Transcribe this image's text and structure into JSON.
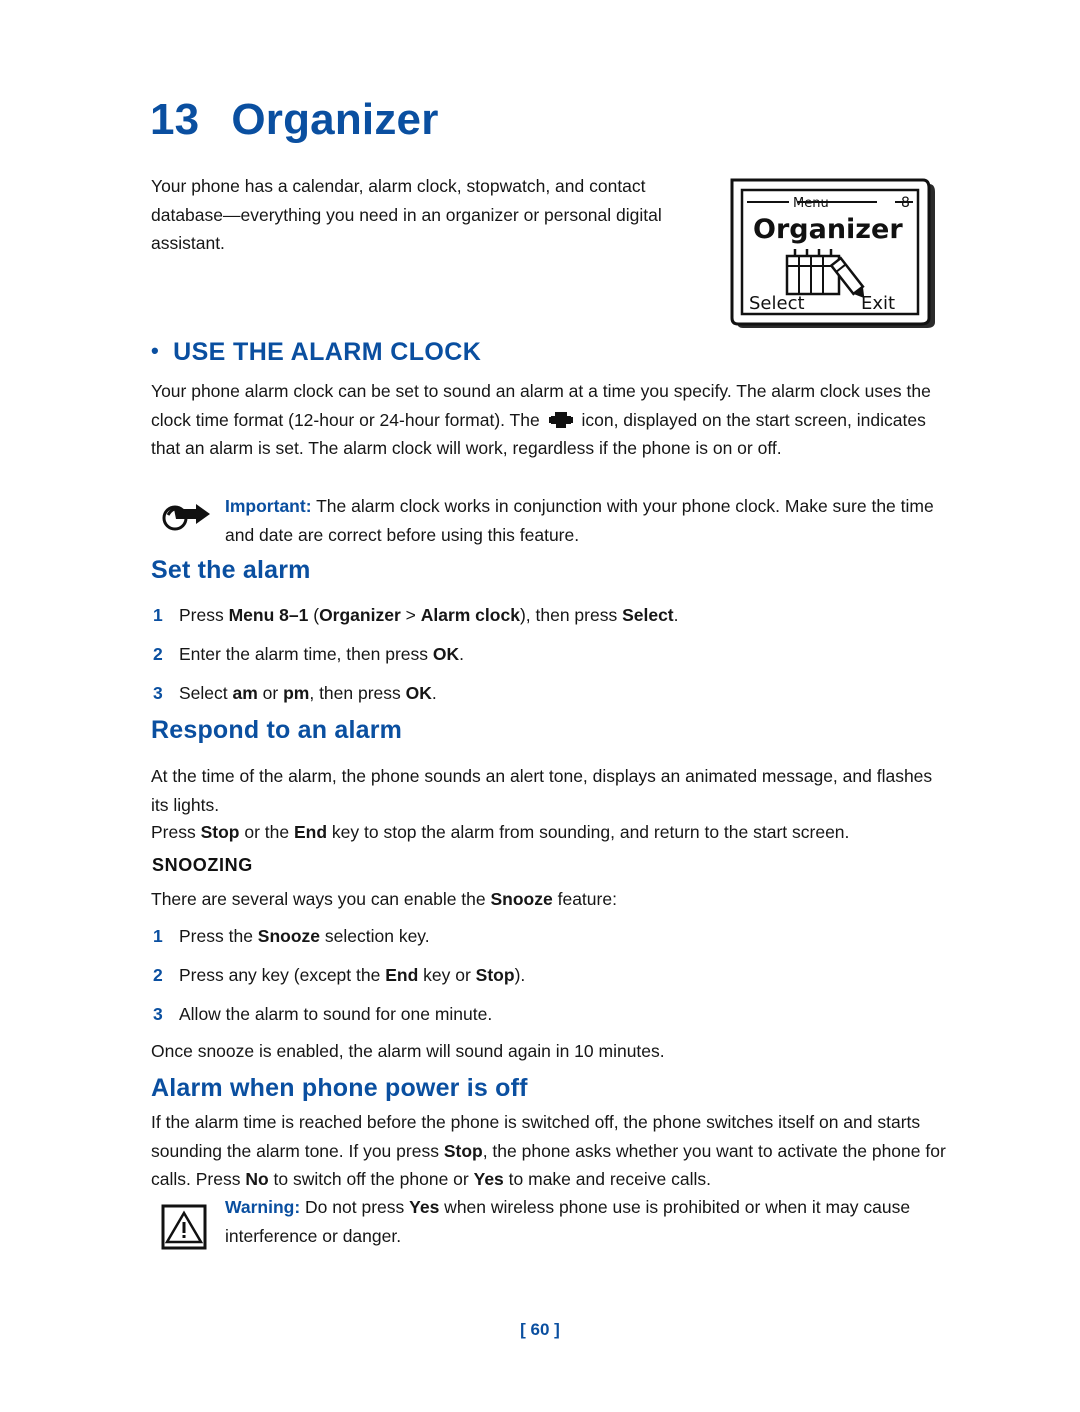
{
  "chapter": {
    "number": "13",
    "title": "Organizer"
  },
  "intro": "Your phone has a calendar, alarm clock, stopwatch, and contact database—everything you need in an organizer or personal digital assistant.",
  "illustration": {
    "name": "organizer-menu-screen",
    "top_left_label": "Menu",
    "top_right_label": "8",
    "title": "Organizer",
    "left_softkey": "Select",
    "right_softkey": "Exit"
  },
  "sections": {
    "alarm_clock": {
      "heading": "USE THE ALARM CLOCK",
      "body_part1": "Your phone alarm clock can be set to sound an alarm at a time you specify. The alarm clock uses the clock time format (12-hour or 24-hour format). The",
      "body_part2": "icon, displayed on the start screen, indicates that an alarm is set. The alarm clock will work, regardless if the phone is on or off."
    },
    "important_note": {
      "lead": "Important:",
      "text": " The alarm clock works in conjunction with your phone clock. Make sure the time and date are correct before using this feature."
    },
    "set_the_alarm": {
      "heading": "Set the alarm",
      "steps": [
        {
          "n": "1",
          "html": "Press <b>Menu 8–1</b> (<b>Organizer</b> &gt; <b>Alarm clock</b>), then press <b>Select</b>."
        },
        {
          "n": "2",
          "html": "Enter the alarm time, then press <b>OK</b>."
        },
        {
          "n": "3",
          "html": "Select <b>am</b> or <b>pm</b>, then press <b>OK</b>."
        }
      ]
    },
    "respond_to_alarm": {
      "heading": "Respond to an alarm",
      "paragraph1": "At the time of the alarm, the phone sounds an alert tone, displays an animated message, and flashes its lights.",
      "paragraph2_html": "Press <b>Stop</b> or the <b>End</b> key to stop the alarm from sounding, and return to the start screen.",
      "snoozing": {
        "heading": "SNOOZING",
        "lead_html": "There are several ways you can enable the <b>Snooze</b> feature:",
        "steps": [
          {
            "n": "1",
            "html": "Press the <b>Snooze</b> selection key."
          },
          {
            "n": "2",
            "html": "Press any key (except the <b>End</b> key or <b>Stop</b>)."
          },
          {
            "n": "3",
            "html": "Allow the alarm to sound for one minute."
          }
        ],
        "closing": "Once snooze is enabled, the alarm will sound again in 10 minutes."
      }
    },
    "power_off": {
      "heading": "Alarm when phone power is off",
      "paragraph_html": "If the alarm time is reached before the phone is switched off, the phone switches itself on and starts sounding the alarm tone. If you press <b>Stop</b>, the phone asks whether you want to activate the phone for calls. Press <b>No</b> to switch off the phone or <b>Yes</b> to make and receive calls."
    },
    "warning_note": {
      "lead": "Warning:",
      "text_html": " Do not press <b>Yes</b> when wireless phone use is prohibited or when it may cause interference or danger."
    }
  },
  "footer": {
    "page_number": "[ 60 ]"
  },
  "colors": {
    "accent_blue": "#0a4fa0",
    "body_text": "#161616",
    "page_background": "#ffffff"
  }
}
